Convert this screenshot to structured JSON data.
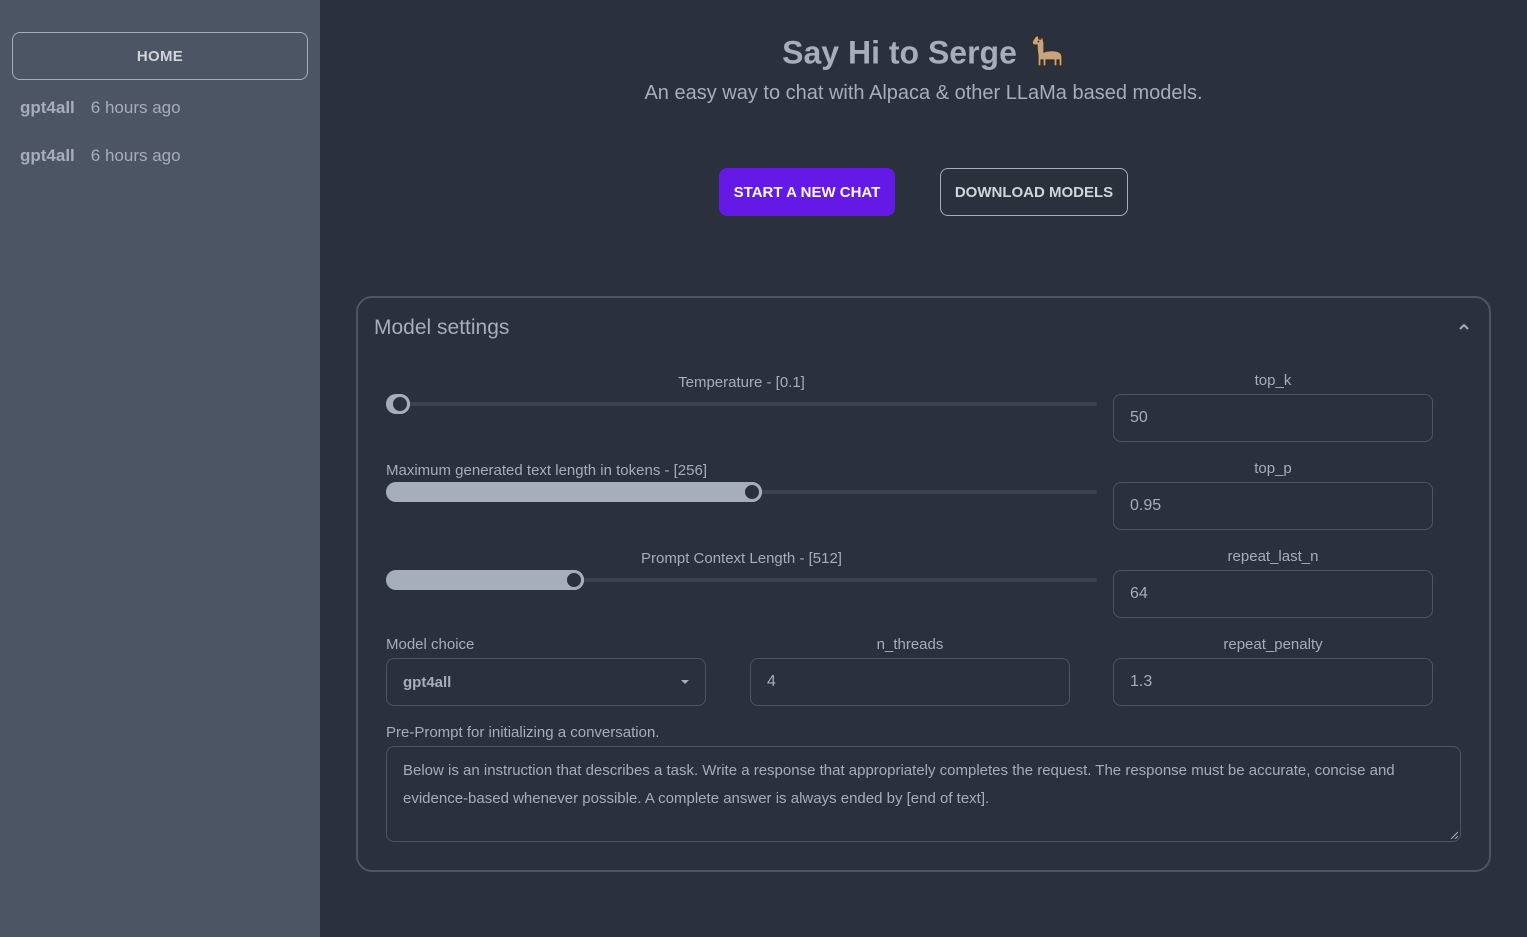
{
  "sidebar": {
    "home_label": "HOME",
    "chats": [
      {
        "name": "gpt4all",
        "time": "6 hours ago"
      },
      {
        "name": "gpt4all",
        "time": "6 hours ago"
      }
    ]
  },
  "header": {
    "title": "Say Hi to Serge",
    "subtitle": "An easy way to chat with Alpaca & other LLaMa based models."
  },
  "actions": {
    "new_chat_label": "START A NEW CHAT",
    "download_label": "DOWNLOAD MODELS"
  },
  "settings": {
    "title": "Model settings",
    "temperature": {
      "label": "Temperature - [0.1]",
      "fraction": 0.005
    },
    "max_length": {
      "label": "Maximum generated text length in tokens - [256]",
      "fraction": 0.5
    },
    "context_length": {
      "label": "Prompt Context Length - [512]",
      "fraction": 0.25
    },
    "top_k": {
      "label": "top_k",
      "value": "50"
    },
    "top_p": {
      "label": "top_p",
      "value": "0.95"
    },
    "repeat_last_n": {
      "label": "repeat_last_n",
      "value": "64"
    },
    "repeat_penalty": {
      "label": "repeat_penalty",
      "value": "1.3"
    },
    "model_choice": {
      "label": "Model choice",
      "value": "gpt4all"
    },
    "n_threads": {
      "label": "n_threads",
      "value": "4"
    },
    "pre_prompt": {
      "label": "Pre-Prompt for initializing a conversation.",
      "value": "Below is an instruction that describes a task. Write a response that appropriately completes the request. The response must be accurate, concise and evidence-based whenever possible. A complete answer is always ended by [end of text]."
    }
  },
  "colors": {
    "accent": "#6419e6",
    "background": "#2a303c",
    "sidebar": "#4b5563"
  }
}
